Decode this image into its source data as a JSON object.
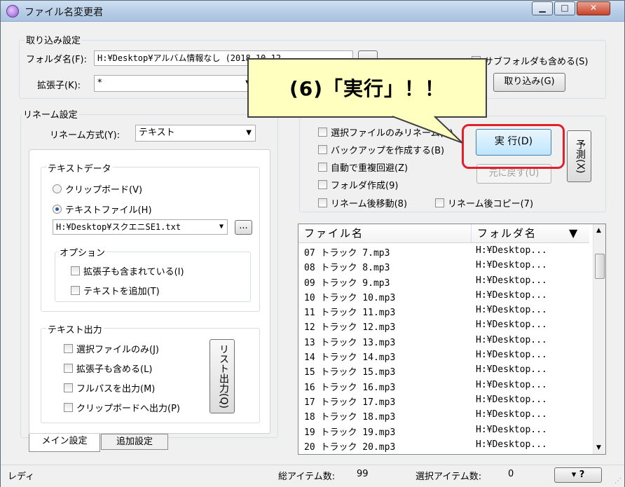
{
  "window": {
    "title": "ファイル名変更君",
    "controls": {
      "minimize": "▁",
      "maximize": "□",
      "close": "✕"
    }
  },
  "import_settings": {
    "group_label": "取り込み設定",
    "folder_label": "フォルダ名(F):",
    "folder_value": "H:¥Desktop¥アルバム情報なし (2018-10-12",
    "browse_label": "...",
    "ext_label": "拡張子(K):",
    "ext_value": "*",
    "subfolder_label": "サブフォルダも含める(S)",
    "import_button": "取り込み(G)"
  },
  "rename_settings": {
    "group_label": "リネーム設定",
    "method_label": "リネーム方式(Y):",
    "method_value": "テキスト",
    "text_data": {
      "group_label": "テキストデータ",
      "clipboard_label": "クリップボード(V)",
      "textfile_label": "テキストファイル(H)",
      "file_value": "H:¥Desktop¥スクエニSE1.txt",
      "browse_label": "...",
      "options_label": "オプション",
      "opt_ext_label": "拡張子も含まれている(I)",
      "opt_append_label": "テキストを追加(T)"
    },
    "text_output": {
      "group_label": "テキスト出力",
      "selected_only": "選択ファイルのみ(J)",
      "include_ext": "拡張子も含める(L)",
      "fullpath": "フルパスを出力(M)",
      "to_clipboard": "クリップボードへ出力(P)",
      "list_button": "リスト出力(Q)"
    }
  },
  "run_options": {
    "selected_only": "選択ファイルのみリネーム(A)",
    "backup": "バックアップを作成する(B)",
    "auto_dup": "自動で重複回避(Z)",
    "create_folder": "フォルダ作成(9)",
    "move_after": "リネーム後移動(8)",
    "copy_after": "リネーム後コピー(7)",
    "run_button": "実 行(D)",
    "undo_button": "元に戻す(U)",
    "preview_button": "予測(X)"
  },
  "file_list": {
    "columns": [
      "ファイル名",
      "フォルダ名"
    ],
    "sort_indicator": "▼",
    "rows": [
      [
        "07 トラック 7.mp3",
        "H:¥Desktop..."
      ],
      [
        "08 トラック 8.mp3",
        "H:¥Desktop..."
      ],
      [
        "09 トラック 9.mp3",
        "H:¥Desktop..."
      ],
      [
        "10 トラック 10.mp3",
        "H:¥Desktop..."
      ],
      [
        "11 トラック 11.mp3",
        "H:¥Desktop..."
      ],
      [
        "12 トラック 12.mp3",
        "H:¥Desktop..."
      ],
      [
        "13 トラック 13.mp3",
        "H:¥Desktop..."
      ],
      [
        "14 トラック 14.mp3",
        "H:¥Desktop..."
      ],
      [
        "15 トラック 15.mp3",
        "H:¥Desktop..."
      ],
      [
        "16 トラック 16.mp3",
        "H:¥Desktop..."
      ],
      [
        "17 トラック 17.mp3",
        "H:¥Desktop..."
      ],
      [
        "18 トラック 18.mp3",
        "H:¥Desktop..."
      ],
      [
        "19 トラック 19.mp3",
        "H:¥Desktop..."
      ],
      [
        "20 トラック 20.mp3",
        "H:¥Desktop..."
      ]
    ]
  },
  "tabs": {
    "main": "メイン設定",
    "extra": "追加設定"
  },
  "status": {
    "ready": "レディ",
    "total_label": "総アイテム数:",
    "total_value": "99",
    "selected_label": "選択アイテム数:",
    "selected_value": "0",
    "help_button": "▾ ?"
  },
  "callout": {
    "text": "(6)「実行」！！"
  },
  "colors": {
    "highlight": "#e0202a",
    "callout_bg": "#ffffc0"
  }
}
